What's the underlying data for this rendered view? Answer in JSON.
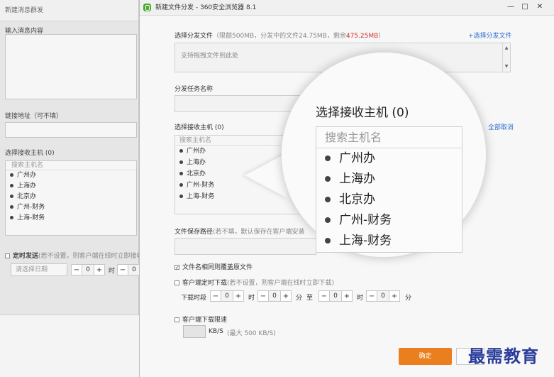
{
  "bg_window": {
    "title": "新建消息群发",
    "msg_label": "输入消息内容",
    "link_label": "链接地址（可不填）",
    "host_label": "选择接收主机 (0)",
    "search_placeholder": "搜索主机名",
    "hosts": [
      "广州办",
      "上海办",
      "北京办",
      "广州-财务",
      "上海-财务"
    ],
    "timed_send_label": "定时发送",
    "timed_send_hint": "(若不设置，则客户端在线时立即接收",
    "date_placeholder": "请选择日期",
    "hour_value": "0",
    "hour_unit": "时",
    "min_value": "0"
  },
  "dialog": {
    "title": "新建文件分发 - 360安全浏览器 8.1",
    "controls": {
      "minimize": "—",
      "maximize": "□",
      "close": "✕"
    },
    "file_section": {
      "label": "选择分发文件",
      "quota_prefix": "（限额500MB，分发中的文件24.75MB，剩余",
      "remaining": "475.25MB",
      "quota_suffix": "）",
      "add_link": "+选择分发文件",
      "drop_hint": "支持拖拽文件到此处"
    },
    "task_name_label": "分发任务名称",
    "host_section": {
      "label": "选择接收主机 (0)",
      "cancel_all": "全部取消",
      "search_placeholder": "搜索主机名",
      "hosts": [
        "广州办",
        "上海办",
        "北京办",
        "广州-财务",
        "上海-财务"
      ]
    },
    "save_path_label": "文件保存路径",
    "save_path_hint": "(若不填，默认保存在客户端安装",
    "overwrite_label": "文件名相同则覆盖原文件",
    "client_timed_label": "客户端定时下载",
    "client_timed_hint": "(若不设置，则客户端在线时立即下载)",
    "period_label": "下载时段",
    "period": {
      "h1": "0",
      "m1": "0",
      "h2": "0",
      "m2": "0",
      "hour_unit": "时",
      "min_unit": "分",
      "to": "至"
    },
    "speed_label": "客户端下载限速",
    "speed_unit": "KB/S",
    "speed_hint": "(最大 500 KB/S)",
    "ok_button": "确定"
  },
  "magnifier": {
    "title": "选择接收主机 (0)",
    "search_placeholder": "搜索主机名",
    "hosts": [
      "广州办",
      "上海办",
      "北京办",
      "广州-财务",
      "上海-财务"
    ]
  },
  "watermark": "最需教育",
  "colors": {
    "accent_orange": "#ec7f1d",
    "link_blue": "#2e6fd0",
    "remaining_red": "#d4322c"
  }
}
